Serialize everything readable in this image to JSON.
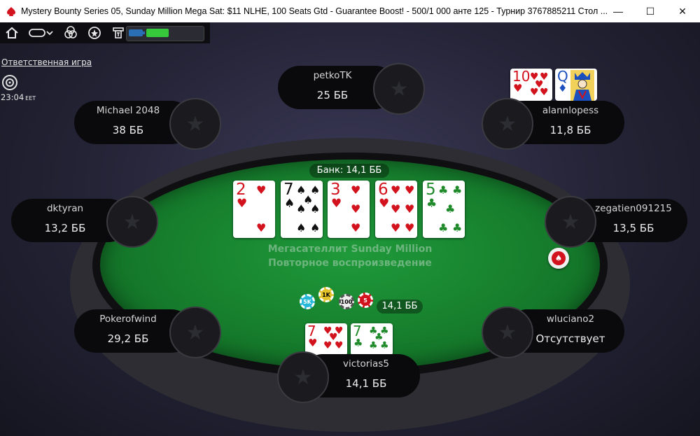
{
  "window": {
    "title": "Mystery Bounty Series 05, Sunday Million Mega Sat: $11 NLHE, 100 Seats Gtd - Guarantee Boost! - 500/1 000 анте 125 - Турнир 3767885211 Стол ...",
    "minimize": "—",
    "maximize": "☐",
    "close": "✕"
  },
  "toolbar": {
    "icons": [
      "home-icon",
      "chat-bubble-icon",
      "cards-icon",
      "chip-icon",
      "cashier-icon"
    ],
    "battery_level": 0.3
  },
  "sidebar": {
    "responsible_gaming": "Ответственная игра",
    "time": "23:04",
    "timezone": "EET"
  },
  "table": {
    "pot_label": "Банк: 14,1 ББ",
    "watermark_line1": "Мегасателлит Sunday Million",
    "watermark_line2": "Повторное воспроизведение",
    "bet_amount": "14,1 ББ",
    "board": [
      {
        "rank": "2",
        "suit": "♥",
        "color": "red"
      },
      {
        "rank": "7",
        "suit": "♠",
        "color": "blk"
      },
      {
        "rank": "3",
        "suit": "♥",
        "color": "red"
      },
      {
        "rank": "6",
        "suit": "♥",
        "color": "red"
      },
      {
        "rank": "5",
        "suit": "♣",
        "color": "grn"
      }
    ],
    "chips": [
      "5K",
      "1K",
      "100",
      "5"
    ]
  },
  "players": [
    {
      "name": "petkoTK",
      "stack": "25 ББ"
    },
    {
      "name": "Michael 2048",
      "stack": "38 ББ"
    },
    {
      "name": "alannlopess",
      "stack": "11,8 ББ"
    },
    {
      "name": "dktyran",
      "stack": "13,2 ББ"
    },
    {
      "name": "zegatien091215",
      "stack": "13,5 ББ"
    },
    {
      "name": "Pokerofwind",
      "stack": "29,2 ББ"
    },
    {
      "name": "wluciano2",
      "stack": "Отсутствует"
    },
    {
      "name": "victorias5",
      "stack": "14,1 ББ"
    }
  ],
  "hole_cards": {
    "alannlopess": [
      {
        "rank": "10",
        "suit": "♥",
        "color": "red"
      },
      {
        "rank": "Q",
        "suit": "♦",
        "color": "blu"
      }
    ],
    "victorias5": [
      {
        "rank": "7",
        "suit": "♥",
        "color": "red"
      },
      {
        "rank": "7",
        "suit": "♣",
        "color": "grn"
      }
    ]
  }
}
